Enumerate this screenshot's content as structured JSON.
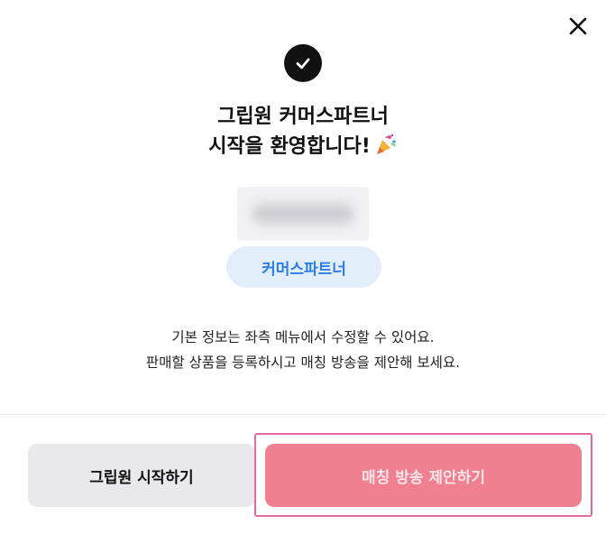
{
  "dialog": {
    "close_icon": "close-icon",
    "success_icon": "check-circle-icon",
    "title_line1": "그립원 커머스파트너",
    "title_line2": "시작을 환영합니다!",
    "title_emoji_icon": "party-popper-icon",
    "profile_name_blurred": true,
    "role_chip": "커머스파트너",
    "description_line1": "기본 정보는 좌측 메뉴에서 수정할 수 있어요.",
    "description_line2": "판매할 상품을 등록하시고 매칭 방송을 제안해 보세요."
  },
  "footer": {
    "start_button": "그립원 시작하기",
    "propose_button": "매칭 방송 제안하기"
  },
  "colors": {
    "chip_bg": "#e3eefb",
    "chip_text": "#2b7de9",
    "secondary_button_bg": "#e9e9ec",
    "primary_button_bg": "#f0808f",
    "highlight_frame": "#e26aa6"
  }
}
